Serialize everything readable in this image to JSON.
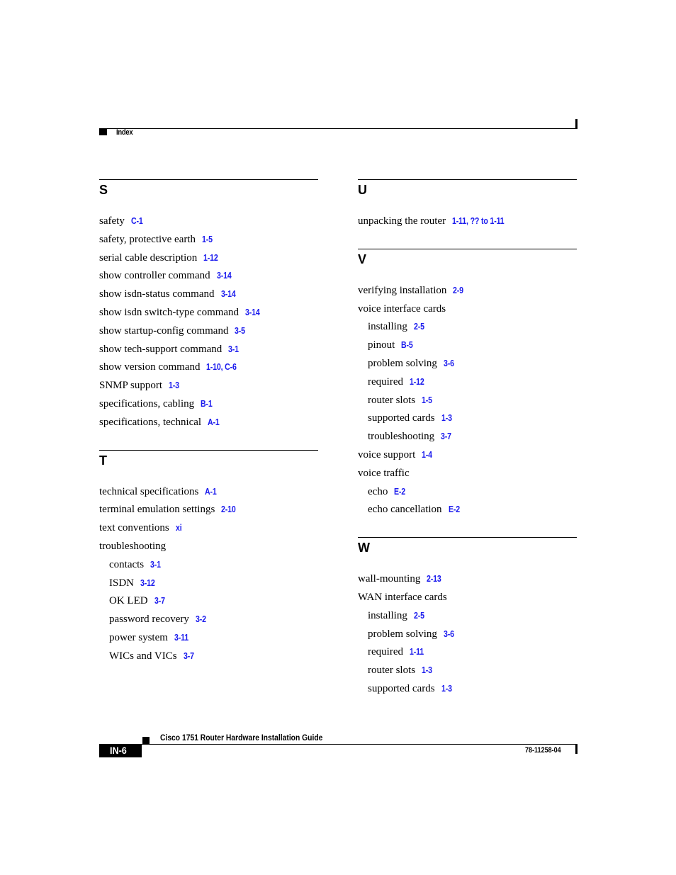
{
  "header": {
    "section_label": "Index"
  },
  "colors": {
    "link": "#1a1aee",
    "text": "#000000"
  },
  "left_column": [
    {
      "letter": "S",
      "entries": [
        {
          "text": "safety",
          "ref": "C-1",
          "sub": false
        },
        {
          "text": "safety, protective earth",
          "ref": "1-5",
          "sub": false
        },
        {
          "text": "serial cable description",
          "ref": "1-12",
          "sub": false
        },
        {
          "text": "show controller command",
          "ref": "3-14",
          "sub": false
        },
        {
          "text": "show isdn-status command",
          "ref": "3-14",
          "sub": false
        },
        {
          "text": "show isdn switch-type command",
          "ref": "3-14",
          "sub": false
        },
        {
          "text": "show startup-config command",
          "ref": "3-5",
          "sub": false
        },
        {
          "text": "show tech-support command",
          "ref": "3-1",
          "sub": false
        },
        {
          "text": "show version command",
          "ref": "1-10, C-6",
          "sub": false
        },
        {
          "text": "SNMP support",
          "ref": "1-3",
          "sub": false
        },
        {
          "text": "specifications, cabling",
          "ref": "B-1",
          "sub": false
        },
        {
          "text": "specifications, technical",
          "ref": "A-1",
          "sub": false
        }
      ]
    },
    {
      "letter": "T",
      "entries": [
        {
          "text": "technical specifications",
          "ref": "A-1",
          "sub": false
        },
        {
          "text": "terminal emulation settings",
          "ref": "2-10",
          "sub": false
        },
        {
          "text": "text conventions",
          "ref": "xi",
          "sub": false
        },
        {
          "text": "troubleshooting",
          "ref": "",
          "sub": false
        },
        {
          "text": "contacts",
          "ref": "3-1",
          "sub": true
        },
        {
          "text": "ISDN",
          "ref": "3-12",
          "sub": true
        },
        {
          "text": "OK LED",
          "ref": "3-7",
          "sub": true
        },
        {
          "text": "password recovery",
          "ref": "3-2",
          "sub": true
        },
        {
          "text": "power system",
          "ref": "3-11",
          "sub": true
        },
        {
          "text": "WICs and VICs",
          "ref": "3-7",
          "sub": true
        }
      ]
    }
  ],
  "right_column": [
    {
      "letter": "U",
      "entries": [
        {
          "text": "unpacking the router",
          "ref": "1-11, ?? to 1-11",
          "sub": false
        }
      ]
    },
    {
      "letter": "V",
      "entries": [
        {
          "text": "verifying installation",
          "ref": "2-9",
          "sub": false
        },
        {
          "text": "voice interface cards",
          "ref": "",
          "sub": false
        },
        {
          "text": "installing",
          "ref": "2-5",
          "sub": true
        },
        {
          "text": "pinout",
          "ref": "B-5",
          "sub": true
        },
        {
          "text": "problem solving",
          "ref": "3-6",
          "sub": true
        },
        {
          "text": "required",
          "ref": "1-12",
          "sub": true
        },
        {
          "text": "router slots",
          "ref": "1-5",
          "sub": true
        },
        {
          "text": "supported cards",
          "ref": "1-3",
          "sub": true
        },
        {
          "text": "troubleshooting",
          "ref": "3-7",
          "sub": true
        },
        {
          "text": "voice support",
          "ref": "1-4",
          "sub": false
        },
        {
          "text": "voice traffic",
          "ref": "",
          "sub": false
        },
        {
          "text": "echo",
          "ref": "E-2",
          "sub": true
        },
        {
          "text": "echo cancellation",
          "ref": "E-2",
          "sub": true
        }
      ]
    },
    {
      "letter": "W",
      "entries": [
        {
          "text": "wall-mounting",
          "ref": "2-13",
          "sub": false
        },
        {
          "text": "WAN interface cards",
          "ref": "",
          "sub": false
        },
        {
          "text": "installing",
          "ref": "2-5",
          "sub": true
        },
        {
          "text": "problem solving",
          "ref": "3-6",
          "sub": true
        },
        {
          "text": "required",
          "ref": "1-11",
          "sub": true
        },
        {
          "text": "router slots",
          "ref": "1-3",
          "sub": true
        },
        {
          "text": "supported cards",
          "ref": "1-3",
          "sub": true
        }
      ]
    }
  ],
  "footer": {
    "book_title": "Cisco 1751 Router Hardware Installation Guide",
    "page_number": "IN-6",
    "doc_number": "78-11258-04"
  }
}
